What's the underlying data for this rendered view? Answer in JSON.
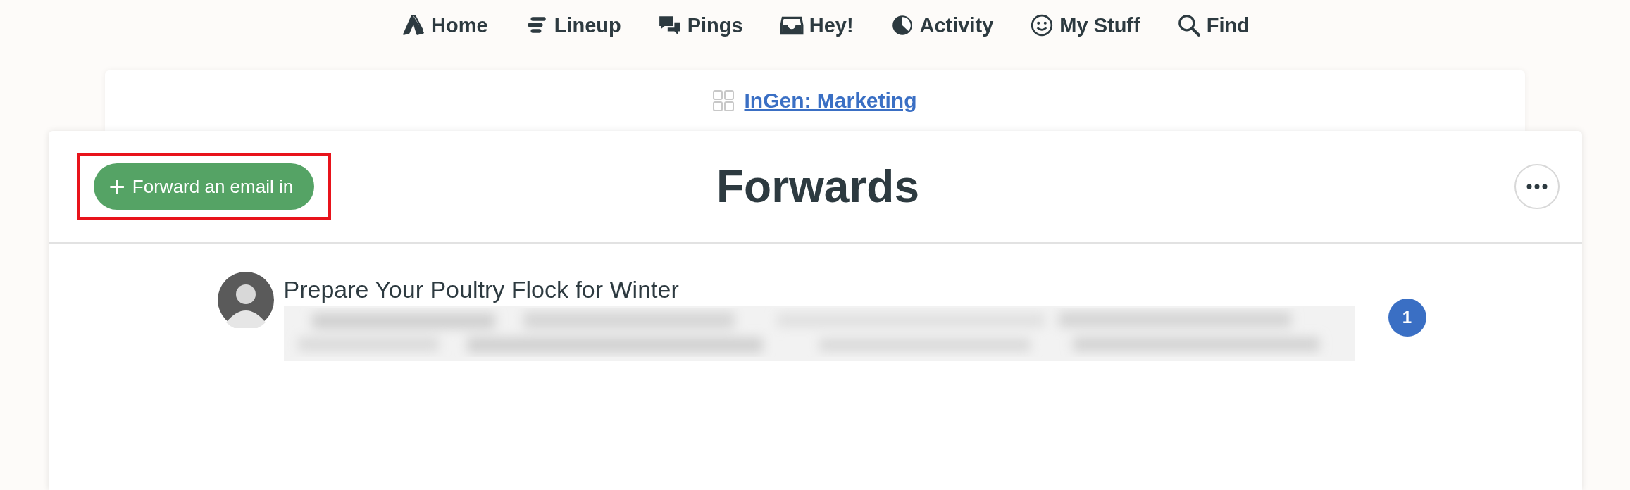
{
  "nav": [
    {
      "label": "Home"
    },
    {
      "label": "Lineup"
    },
    {
      "label": "Pings"
    },
    {
      "label": "Hey!"
    },
    {
      "label": "Activity"
    },
    {
      "label": "My Stuff"
    },
    {
      "label": "Find"
    }
  ],
  "breadcrumb": {
    "label": "InGen: Marketing"
  },
  "header": {
    "title": "Forwards",
    "add_button": {
      "icon": "+",
      "label": "Forward an email in",
      "highlighted": true
    }
  },
  "items": [
    {
      "title": "Prepare Your Poultry Flock for Winter",
      "badge": "1"
    }
  ]
}
